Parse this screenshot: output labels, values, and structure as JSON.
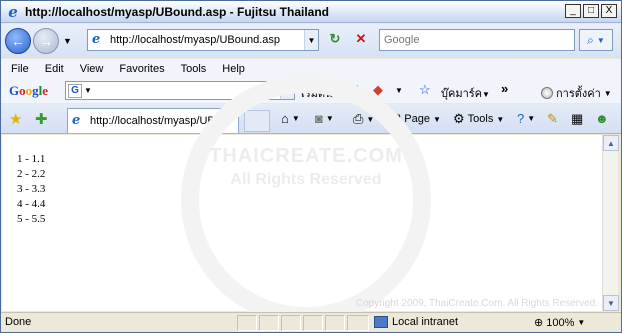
{
  "window": {
    "title": "http://localhost/myasp/UBound.asp - Fujitsu Thailand",
    "minimize": "_",
    "maximize": "□",
    "close": "X"
  },
  "address_bar": {
    "url": "http://localhost/myasp/UBound.asp",
    "search_placeholder": "Google",
    "back_arrow": "←",
    "forward_arrow": "→",
    "refresh_symbol": "↻",
    "stop_symbol": "✕",
    "search_go_symbol": "⌕"
  },
  "menu": [
    "File",
    "Edit",
    "View",
    "Favorites",
    "Tools",
    "Help"
  ],
  "google_toolbar": {
    "logo_letters": [
      "G",
      "o",
      "o",
      "g",
      "l",
      "e"
    ],
    "start_label": "เริ่มต้น",
    "bookmarks_label": "บุ๊คมาร์ค",
    "more_symbol": "»",
    "settings_label": "การตั้งค่า"
  },
  "tabs": [
    {
      "title": "http://localhost/myasp/UBo..."
    }
  ],
  "command_bar": {
    "page_label": "Page",
    "tools_label": "Tools"
  },
  "page": {
    "output_lines": [
      "1 - 1.1",
      "2 - 2.2",
      "3 - 3.3",
      "4 - 4.4",
      "5 - 5.5"
    ],
    "watermark_line1": "THAICREATE.COM",
    "watermark_line2": "All Rights Reserved",
    "copyright": "Copyright 2009, ThaiCreate.Com. All Rights Reserved."
  },
  "status_bar": {
    "status": "Done",
    "zone": "Local intranet",
    "zoom": "100%"
  },
  "colors": {
    "accent": "#1d5fc7",
    "titlebar": "#c6d6ef"
  }
}
